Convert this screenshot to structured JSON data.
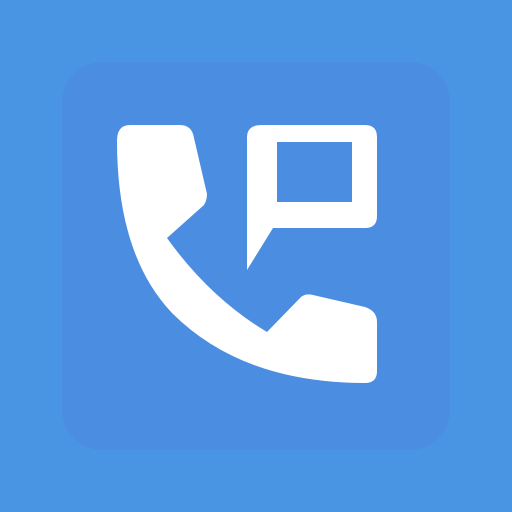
{
  "app_icon": {
    "icons": [
      "phone-handset-icon",
      "speech-bubble-icon"
    ],
    "colors": {
      "background": "#4A94E4",
      "tile": "#4A8DE1",
      "glyph": "#FFFFFF"
    }
  }
}
